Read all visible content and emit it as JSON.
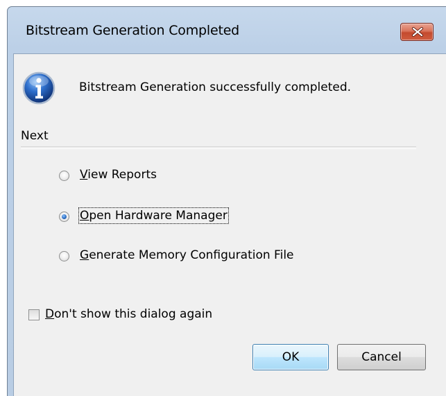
{
  "window": {
    "title": "Bitstream Generation Completed"
  },
  "message": {
    "text": "Bitstream Generation successfully completed."
  },
  "next": {
    "label": "Next",
    "options": [
      {
        "mnemonic": "V",
        "rest": "iew Reports",
        "selected": false
      },
      {
        "mnemonic": "O",
        "rest": "pen Hardware Manager",
        "selected": true
      },
      {
        "mnemonic": "G",
        "rest": "enerate Memory Configuration File",
        "selected": false
      }
    ]
  },
  "dont_show": {
    "mnemonic": "D",
    "rest": "on't show this dialog again",
    "checked": false
  },
  "buttons": {
    "ok_label": "OK",
    "cancel_label": "Cancel"
  },
  "icons": {
    "info": "info-icon",
    "close": "close-icon"
  },
  "colors": {
    "titlebar": "#bcd0e7",
    "close_button": "#c44a2e",
    "dialog_background": "#f0f0f0"
  }
}
